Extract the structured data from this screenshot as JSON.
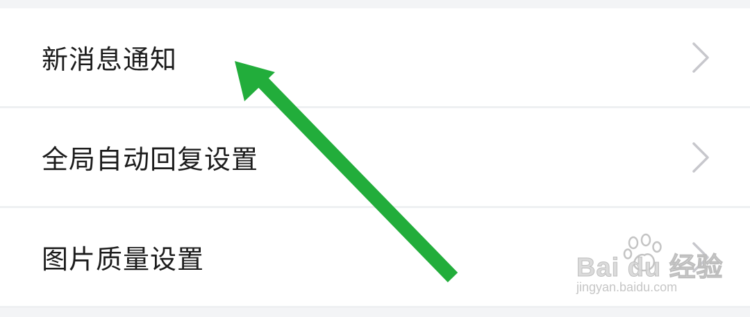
{
  "settings": {
    "items": [
      {
        "label": "新消息通知"
      },
      {
        "label": "全局自动回复设置"
      },
      {
        "label": "图片质量设置"
      }
    ]
  },
  "icons": {
    "chevron": "chevron-right-icon",
    "annotation": "arrow-annotation-icon"
  },
  "watermark": {
    "brand": "Bai du 经验",
    "url": "jingyan.baidu.com"
  },
  "colors": {
    "arrow": "#22ad3b",
    "chevron": "#c7c7cc",
    "background": "#f3f4f6",
    "row": "#ffffff"
  }
}
